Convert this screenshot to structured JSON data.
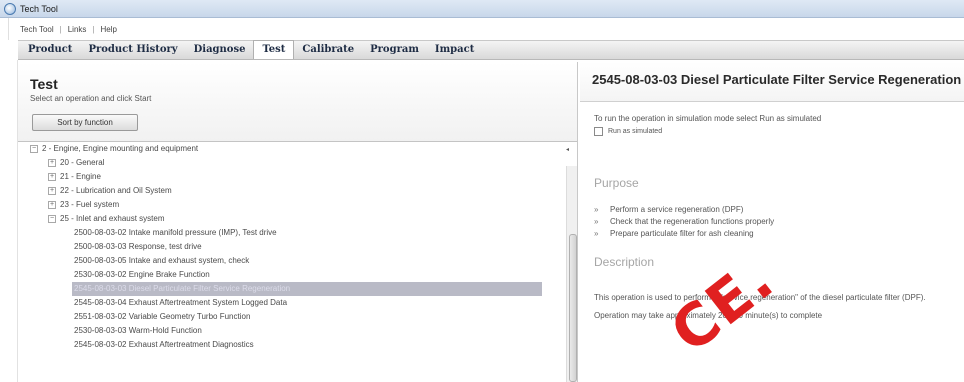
{
  "window": {
    "title": "Tech Tool"
  },
  "menu": [
    "Tech Tool",
    "Links",
    "Help"
  ],
  "tabs": [
    {
      "label": "Product",
      "active": false
    },
    {
      "label": "Product History",
      "active": false
    },
    {
      "label": "Diagnose",
      "active": false
    },
    {
      "label": "Test",
      "active": true
    },
    {
      "label": "Calibrate",
      "active": false
    },
    {
      "label": "Program",
      "active": false
    },
    {
      "label": "Impact",
      "active": false
    }
  ],
  "left": {
    "title": "Test",
    "instructions": "Select an operation and click Start",
    "sort_button": "Sort by function"
  },
  "tree": [
    {
      "label": "2 - Engine, Engine mounting and equipment",
      "toggle": "−",
      "level": 0
    },
    {
      "label": "20 - General",
      "toggle": "+",
      "level": 1
    },
    {
      "label": "21 - Engine",
      "toggle": "+",
      "level": 1
    },
    {
      "label": "22 - Lubrication and Oil System",
      "toggle": "+",
      "level": 1
    },
    {
      "label": "23 - Fuel system",
      "toggle": "+",
      "level": 1
    },
    {
      "label": "25 - Inlet and exhaust system",
      "toggle": "−",
      "level": 1
    },
    {
      "label": "2500-08-03-02 Intake manifold pressure (IMP), Test drive",
      "level": 2
    },
    {
      "label": "2500-08-03-03 Response, test drive",
      "level": 2
    },
    {
      "label": "2500-08-03-05 Intake and exhaust system, check",
      "level": 2
    },
    {
      "label": "2530-08-03-02 Engine Brake Function",
      "level": 2
    },
    {
      "label": "2545-08-03-03 Diesel Particulate Filter Service Regeneration",
      "level": 2,
      "selected": true
    },
    {
      "label": "2545-08-03-04 Exhaust Aftertreatment System Logged Data",
      "level": 2
    },
    {
      "label": "2551-08-03-02 Variable Geometry Turbo Function",
      "level": 2
    },
    {
      "label": "2530-08-03-03 Warm-Hold Function",
      "level": 2
    },
    {
      "label": "2545-08-03-02 Exhaust Aftertreatment Diagnostics",
      "level": 2
    }
  ],
  "right": {
    "title": "2545-08-03-03 Diesel Particulate Filter Service Regeneration",
    "simulation_text": "To run the operation in simulation mode select Run as simulated",
    "run_simulated_label": "Run as simulated",
    "run_simulated_checked": false,
    "purpose_heading": "Purpose",
    "purpose_items": [
      "Perform a service regeneration (DPF)",
      "Check that the regeneration functions properly",
      "Prepare particulate filter for ash cleaning"
    ],
    "description_heading": "Description",
    "description_text": "This operation is used to perform a \"service regeneration\" of the diesel particulate filter (DPF).",
    "duration_text": "Operation may take approximately 20 - 30 minute(s) to complete"
  },
  "watermark": "CE."
}
